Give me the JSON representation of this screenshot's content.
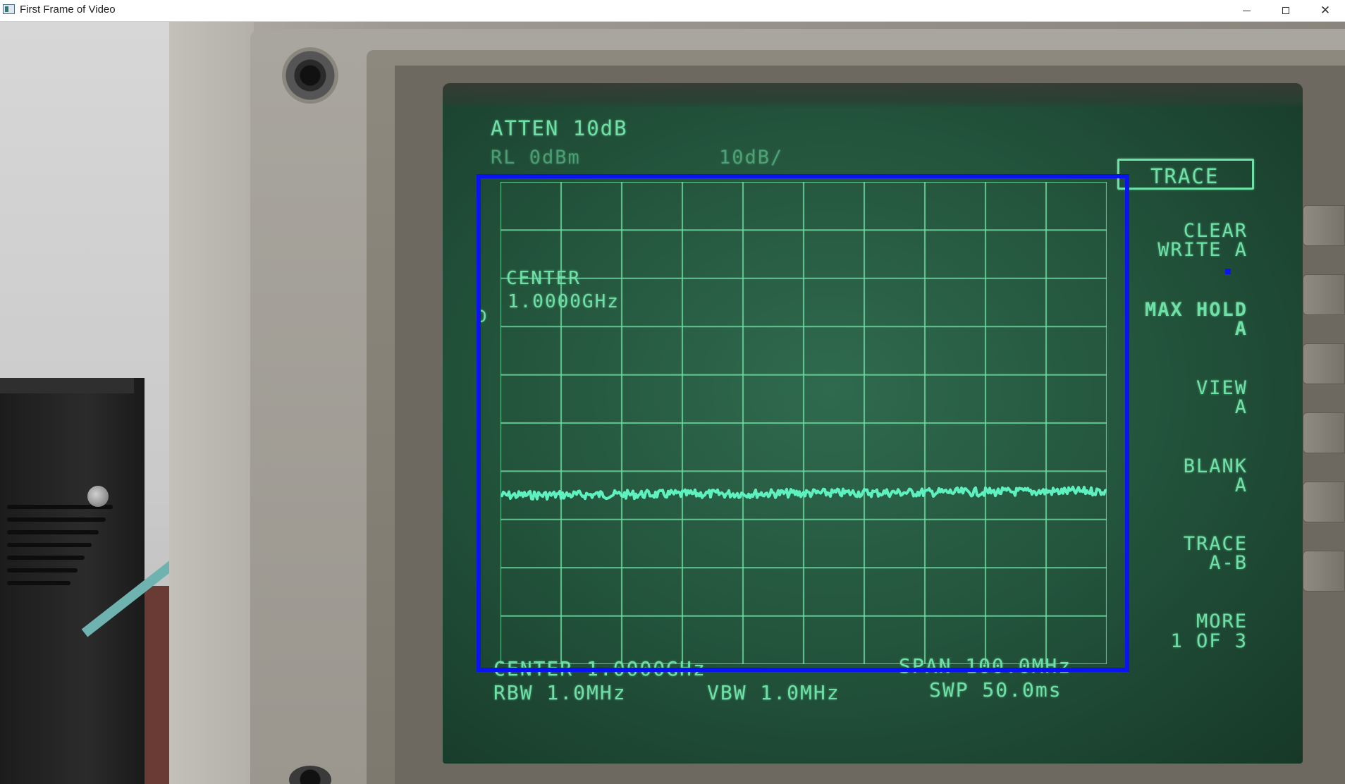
{
  "window": {
    "title": "First Frame of Video",
    "minimize_glyph": "—",
    "maximize_glyph": "☐",
    "close_glyph": "✕"
  },
  "analyzer": {
    "header": {
      "atten": "ATTEN 10dB",
      "ref_level": "RL 0dBm",
      "scale": "10dB/"
    },
    "grid_annotation": {
      "center_label": "CENTER",
      "center_value": "1.0000GHz",
      "marker": "D"
    },
    "footer": {
      "center": "CENTER 1.0000GHz",
      "rbw": "RBW 1.0MHz",
      "vbw": "VBW 1.0MHz",
      "span": "SPAN 100.0MHz",
      "sweep": "SWP 50.0ms"
    },
    "menu": {
      "title": "TRACE",
      "softkeys": [
        {
          "line1": "CLEAR",
          "line2": "WRITE A"
        },
        {
          "line1": "MAX HOLD",
          "line2": "A"
        },
        {
          "line1": "VIEW",
          "line2": "A"
        },
        {
          "line1": "BLANK",
          "line2": "A"
        },
        {
          "line1": "TRACE",
          "line2": "A-B"
        },
        {
          "line1": "MORE",
          "line2": "1 OF 3"
        }
      ]
    },
    "graticule": {
      "columns": 10,
      "rows": 10
    },
    "trace_level_fraction_from_top": 0.65
  },
  "colors": {
    "phosphor": "#6fe0a6",
    "trace": "#5ff0c0",
    "roi": "#0a14f0"
  }
}
